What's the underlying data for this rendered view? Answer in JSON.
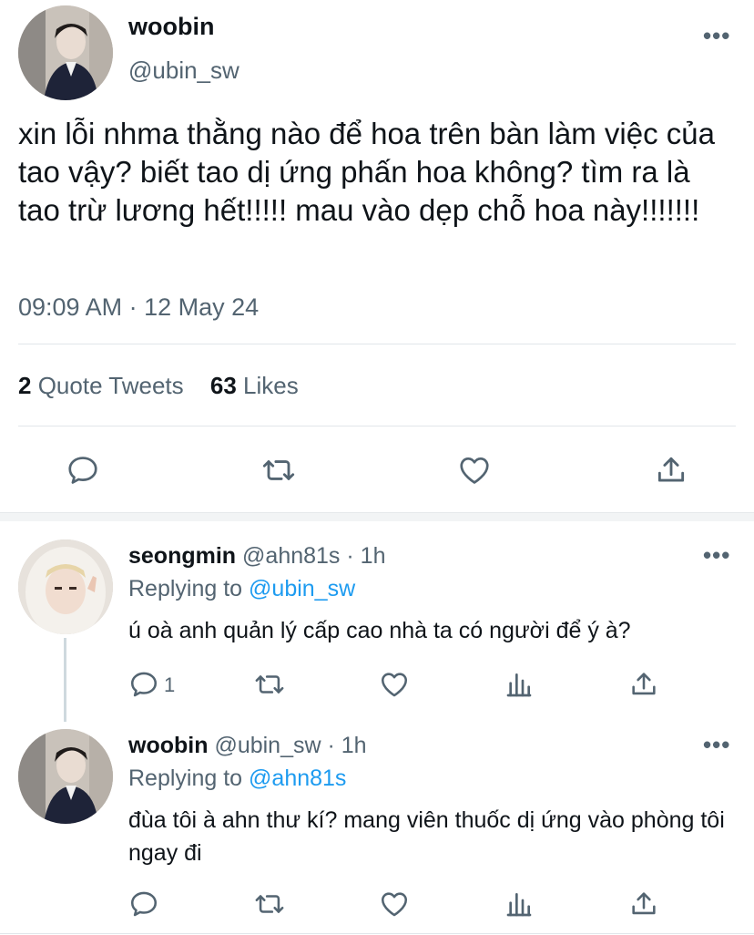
{
  "main_tweet": {
    "display_name": "woobin",
    "handle": "@ubin_sw",
    "text": "xin lỗi nhma thằng nào để hoa trên bàn làm việc của tao vậy? biết tao dị ứng phấn hoa không? tìm ra là tao trừ lương hết!!!!! mau vào dẹp chỗ hoa này!!!!!!!",
    "timestamp": "09:09 AM · 12 May 24",
    "quote_tweets_count": "2",
    "quote_tweets_label": "Quote Tweets",
    "likes_count": "63",
    "likes_label": "Likes",
    "more": "•••"
  },
  "replies": [
    {
      "display_name": "seongmin",
      "handle": "@ahn81s",
      "time": "· 1h",
      "replying_prefix": "Replying to",
      "replying_handle": "@ubin_sw",
      "text": "ú oà anh quản lý cấp cao nhà ta có người để ý à?",
      "reply_count": "1",
      "more": "•••"
    },
    {
      "display_name": "woobin",
      "handle": "@ubin_sw",
      "time": "· 1h",
      "replying_prefix": "Replying to",
      "replying_handle": "@ahn81s",
      "text": "đùa tôi à ahn thư kí? mang viên thuốc dị ứng vào phòng tôi ngay đi",
      "more": "•••"
    }
  ],
  "icons": [
    "reply-icon",
    "retweet-icon",
    "like-icon",
    "share-icon",
    "analytics-icon",
    "more-icon"
  ],
  "colors": {
    "link": "#1d9bf0",
    "secondary": "#536471",
    "text": "#0f1419",
    "divider": "#e1e6ea"
  }
}
